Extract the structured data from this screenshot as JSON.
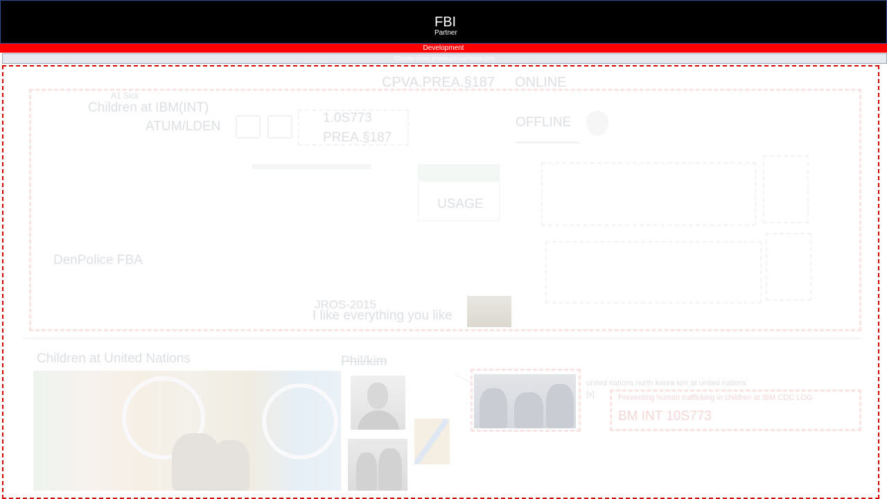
{
  "header": {
    "title": "FBI",
    "subtitle": "Partner"
  },
  "env_bar": {
    "label": "Development"
  },
  "url_bar": {
    "text": "Chrome-menu-phrase-phrase-home.com"
  },
  "top_row": {
    "left_label": "CPVA.PREA.§187",
    "right_label": "ONLINE"
  },
  "panel": {
    "small_label": "A1 Sick",
    "children_label": "Children at IBM(INT)",
    "atum_label": "ATUM/LDEN",
    "code_line1": "1.0S773",
    "code_line2": "PREA.§187",
    "offline_label": "OFFLINE",
    "usage_label": "USAGE",
    "police_label": "DenPolice FBA",
    "date_label": "JROS-2015",
    "caption": "I like everything you like"
  },
  "lower": {
    "children_un_heading": "Children at United Nations",
    "phil_kim_heading": "Phil/kim",
    "meeting_caption": "united nations north korea kim at united nations",
    "close_label": "[x]",
    "red_note": "Preventing human trafficking in children at IBM CDC LOG",
    "bm_code": "BM INT 10S773"
  },
  "colors": {
    "header_bg": "#000000",
    "env_bar_bg": "#ff0000",
    "frame_border": "#d40000",
    "faint_text": "#dcdfe3"
  }
}
